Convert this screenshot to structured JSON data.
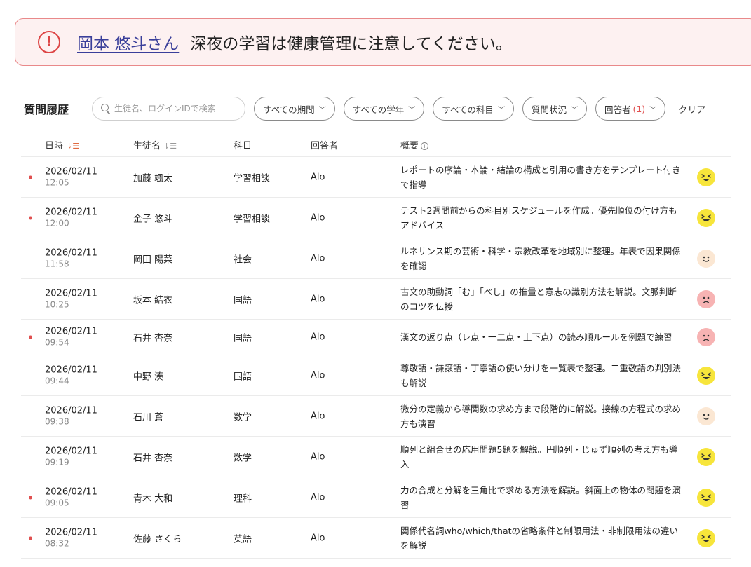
{
  "alert": {
    "name": "岡本 悠斗さん",
    "message": "深夜の学習は健康管理に注意してください。",
    "color": "#dd4444"
  },
  "toolbar": {
    "title": "質問履歴",
    "search_placeholder": "生徒名、ログインIDで検索",
    "filters": {
      "period": "すべての期間",
      "grade": "すべての学年",
      "subject": "すべての科目",
      "status": "質問状況",
      "answerer": "回答者",
      "answerer_count": "(1)"
    },
    "clear": "クリア"
  },
  "table": {
    "headers": {
      "date": "日時",
      "student": "生徒名",
      "subject": "科目",
      "answerer": "回答者",
      "summary": "概要"
    },
    "rows": [
      {
        "unread": true,
        "date": "2026/02/11",
        "time": "12:05",
        "student": "加藤 颯太",
        "subject": "学習相談",
        "answerer": "Alo",
        "summary": "レポートの序論・本論・結論の構成と引用の書き方をテンプレート付きで指導",
        "mood": "happy"
      },
      {
        "unread": true,
        "date": "2026/02/11",
        "time": "12:00",
        "student": "金子 悠斗",
        "subject": "学習相談",
        "answerer": "Alo",
        "summary": "テスト2週間前からの科目別スケジュールを作成。優先順位の付け方もアドバイス",
        "mood": "happy"
      },
      {
        "unread": false,
        "date": "2026/02/11",
        "time": "11:58",
        "student": "岡田 陽菜",
        "subject": "社会",
        "answerer": "Alo",
        "summary": "ルネサンス期の芸術・科学・宗教改革を地域別に整理。年表で因果関係を確認",
        "mood": "neutral"
      },
      {
        "unread": false,
        "date": "2026/02/11",
        "time": "10:25",
        "student": "坂本 結衣",
        "subject": "国語",
        "answerer": "Alo",
        "summary": "古文の助動詞「む」「べし」の推量と意志の識別方法を解説。文脈判断のコツを伝授",
        "mood": "sad"
      },
      {
        "unread": true,
        "date": "2026/02/11",
        "time": "09:54",
        "student": "石井 杏奈",
        "subject": "国語",
        "answerer": "Alo",
        "summary": "漢文の返り点（レ点・一二点・上下点）の読み順ルールを例題で練習",
        "mood": "sad"
      },
      {
        "unread": false,
        "date": "2026/02/11",
        "time": "09:44",
        "student": "中野 湊",
        "subject": "国語",
        "answerer": "Alo",
        "summary": "尊敬語・謙譲語・丁寧語の使い分けを一覧表で整理。二重敬語の判別法も解説",
        "mood": "happy"
      },
      {
        "unread": false,
        "date": "2026/02/11",
        "time": "09:38",
        "student": "石川 蒼",
        "subject": "数学",
        "answerer": "Alo",
        "summary": "微分の定義から導関数の求め方まで段階的に解説。接線の方程式の求め方も演習",
        "mood": "neutral"
      },
      {
        "unread": false,
        "date": "2026/02/11",
        "time": "09:19",
        "student": "石井 杏奈",
        "subject": "数学",
        "answerer": "Alo",
        "summary": "順列と組合せの応用問題5題を解説。円順列・じゅず順列の考え方も導入",
        "mood": "happy"
      },
      {
        "unread": true,
        "date": "2026/02/11",
        "time": "09:05",
        "student": "青木 大和",
        "subject": "理科",
        "answerer": "Alo",
        "summary": "力の合成と分解を三角比で求める方法を解説。斜面上の物体の問題を演習",
        "mood": "happy"
      },
      {
        "unread": true,
        "date": "2026/02/11",
        "time": "08:32",
        "student": "佐藤 さくら",
        "subject": "英語",
        "answerer": "Alo",
        "summary": "関係代名詞who/which/thatの省略条件と制限用法・非制限用法の違いを解説",
        "mood": "happy"
      }
    ]
  }
}
